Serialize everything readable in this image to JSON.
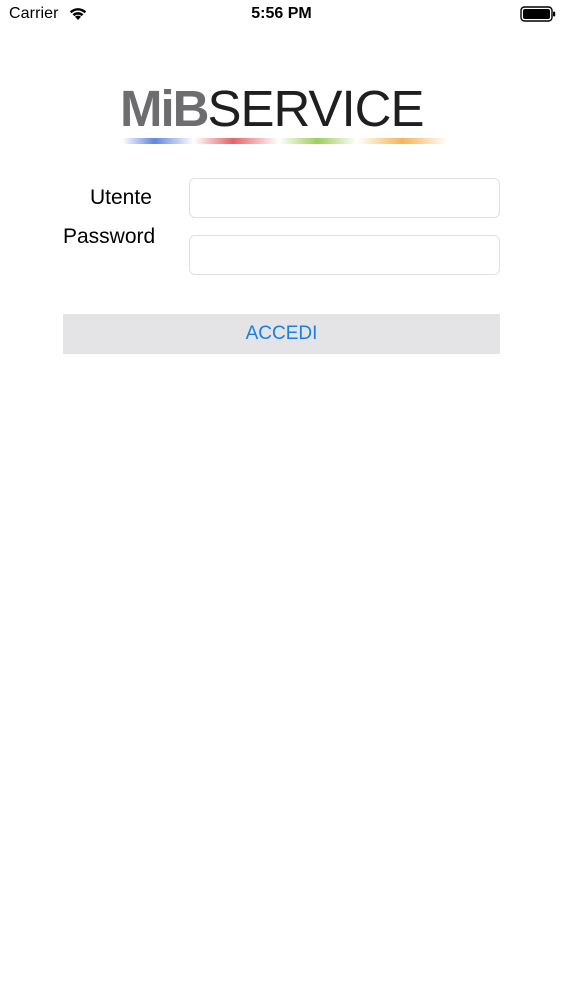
{
  "status_bar": {
    "carrier": "Carrier",
    "time": "5:56 PM",
    "wifi_icon": "wifi-icon",
    "battery_icon": "battery-icon"
  },
  "logo": {
    "part1": "MiB",
    "part2": "SERVICE",
    "colors": {
      "mib": "#6d6d6f",
      "service": "#1f1f1f",
      "stripe": [
        "#4a6fd8",
        "#e0484b",
        "#8cc63f",
        "#f0a93a"
      ]
    }
  },
  "form": {
    "user_label": "Utente",
    "user_value": "",
    "password_label": "Password",
    "password_value": "",
    "login_label": "ACCEDI"
  },
  "colors": {
    "accent": "#1a7fe0",
    "button_bg": "#e4e4e6",
    "input_border": "#e0e0e0"
  }
}
